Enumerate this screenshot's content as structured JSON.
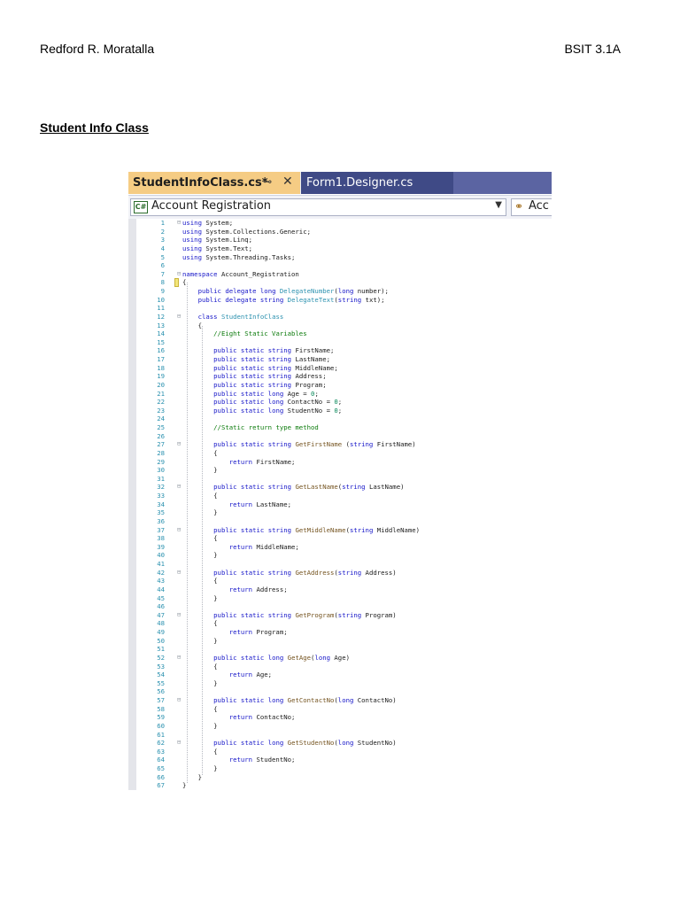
{
  "header": {
    "author": "Redford R. Moratalla",
    "section": "BSIT 3.1A"
  },
  "heading": "Student Info Class",
  "ide": {
    "tabs": [
      {
        "label": "StudentInfoClass.cs*",
        "active": true
      },
      {
        "label": "Form1.Designer.cs",
        "active": false
      }
    ],
    "pin_icon": "⊸",
    "close_icon": "✕",
    "nav": {
      "project": "Account Registration",
      "project_icon": "C#",
      "member": "Acc",
      "member_icon": "⚭"
    },
    "code_lines": [
      "using System;",
      "using System.Collections.Generic;",
      "using System.Linq;",
      "using System.Text;",
      "using System.Threading.Tasks;",
      "",
      "namespace Account_Registration",
      "{",
      "    public delegate long DelegateNumber(long number);",
      "    public delegate string DelegateText(string txt);",
      "",
      "    class StudentInfoClass",
      "    {",
      "        //Eight Static Variables",
      "",
      "        public static string FirstName;",
      "        public static string LastName;",
      "        public static string MiddleName;",
      "        public static string Address;",
      "        public static string Program;",
      "        public static long Age = 0;",
      "        public static long ContactNo = 0;",
      "        public static long StudentNo = 0;",
      "",
      "        //Static return type method",
      "",
      "        public static string GetFirstName (string FirstName)",
      "        {",
      "            return FirstName;",
      "        }",
      "",
      "        public static string GetLastName(string LastName)",
      "        {",
      "            return LastName;",
      "        }",
      "",
      "        public static string GetMiddleName(string MiddleName)",
      "        {",
      "            return MiddleName;",
      "        }",
      "",
      "        public static string GetAddress(string Address)",
      "        {",
      "            return Address;",
      "        }",
      "",
      "        public static string GetProgram(string Program)",
      "        {",
      "            return Program;",
      "        }",
      "",
      "        public static long GetAge(long Age)",
      "        {",
      "            return Age;",
      "        }",
      "",
      "        public static long GetContactNo(long ContactNo)",
      "        {",
      "            return ContactNo;",
      "        }",
      "",
      "        public static long GetStudentNo(long StudentNo)",
      "        {",
      "            return StudentNo;",
      "        }",
      "    }",
      "}"
    ]
  }
}
